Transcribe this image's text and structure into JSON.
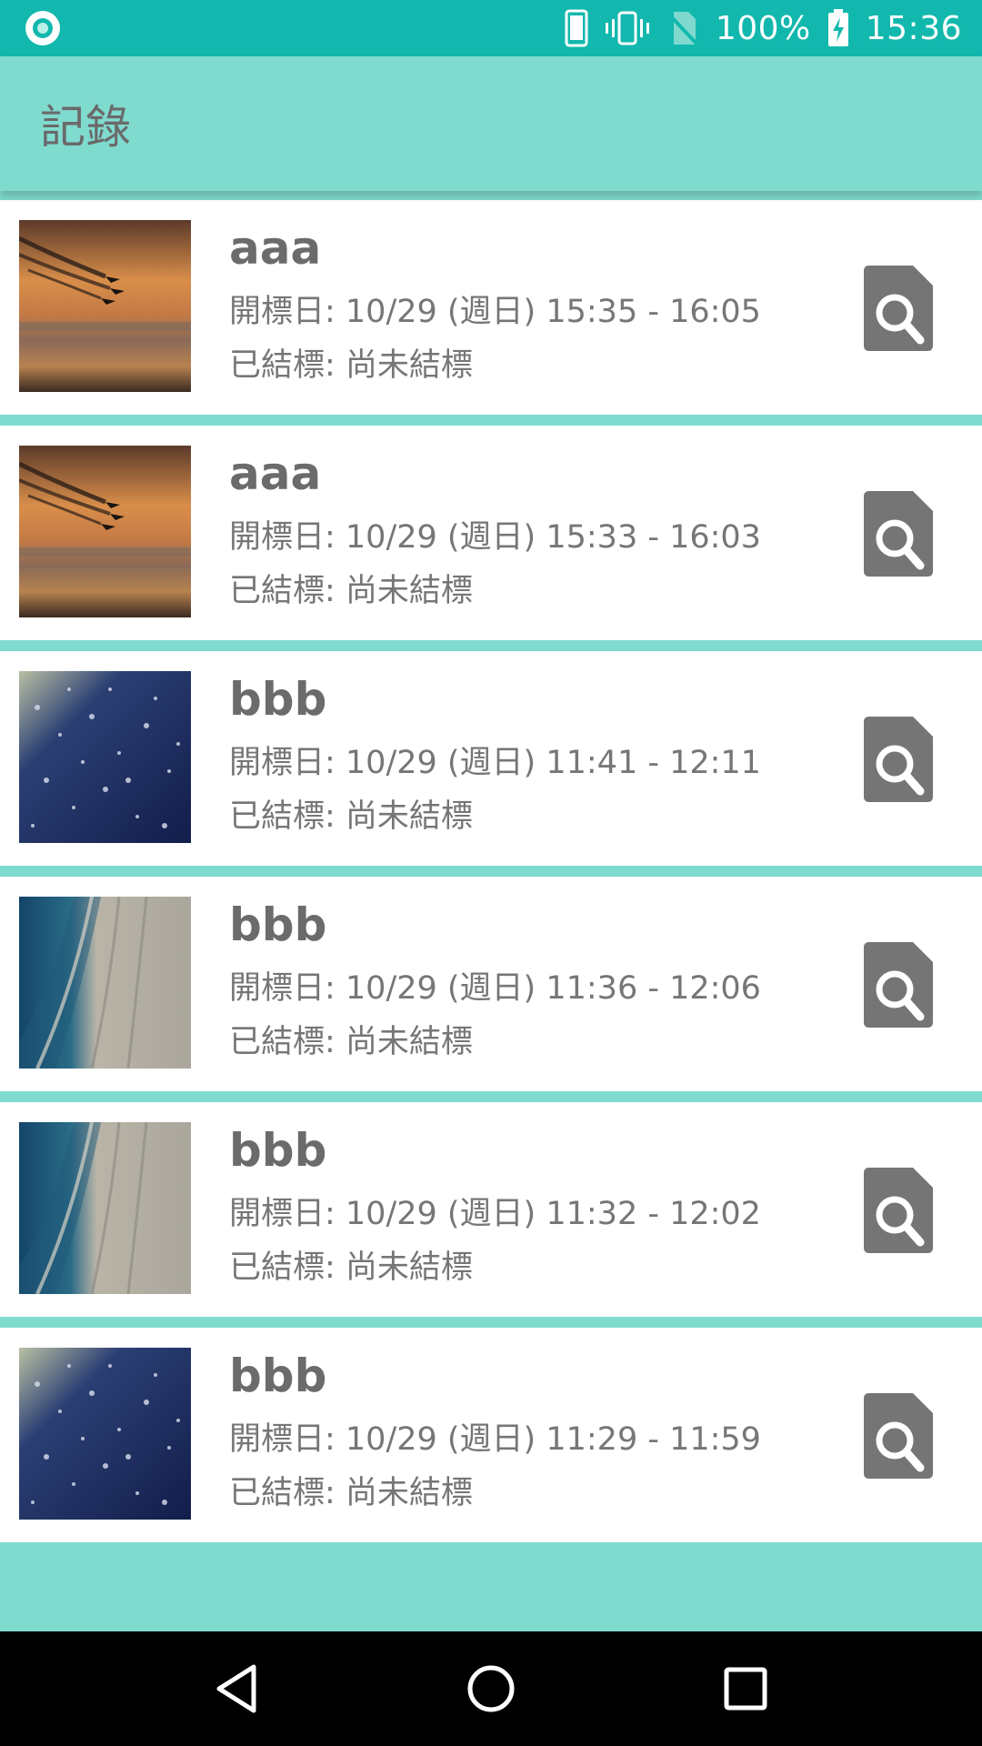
{
  "status_bar": {
    "battery": "100%",
    "time": "15:36",
    "icons": [
      "notification-icon",
      "phone-icon",
      "vibrate-icon",
      "no-sim-icon",
      "battery-charging-icon"
    ]
  },
  "app_bar": {
    "title": "記錄"
  },
  "items": [
    {
      "title": "aaa",
      "open_date": "開標日: 10/29 (週日) 15:35 - 16:05",
      "status": "已結標: 尚未結標",
      "thumbnail": "airplanes-sunset",
      "action_icon": "search-icon"
    },
    {
      "title": "aaa",
      "open_date": "開標日: 10/29 (週日) 15:33 - 16:03",
      "status": "已結標: 尚未結標",
      "thumbnail": "airplanes-sunset",
      "action_icon": "search-icon"
    },
    {
      "title": "bbb",
      "open_date": "開標日: 10/29 (週日) 11:41 - 12:11",
      "status": "已結標: 尚未結標",
      "thumbnail": "water-drops",
      "action_icon": "search-icon"
    },
    {
      "title": "bbb",
      "open_date": "開標日: 10/29 (週日) 11:36 - 12:06",
      "status": "已結標: 尚未結標",
      "thumbnail": "beach-aerial",
      "action_icon": "search-icon"
    },
    {
      "title": "bbb",
      "open_date": "開標日: 10/29 (週日) 11:32 - 12:02",
      "status": "已結標: 尚未結標",
      "thumbnail": "beach-aerial",
      "action_icon": "search-icon"
    },
    {
      "title": "bbb",
      "open_date": "開標日: 10/29 (週日) 11:29 - 11:59",
      "status": "已結標: 尚未結標",
      "thumbnail": "water-drops",
      "action_icon": "search-icon"
    }
  ],
  "nav_bar": {
    "icons": [
      "back-icon",
      "home-icon",
      "recents-icon"
    ]
  },
  "colors": {
    "status_bar": "#12B8AD",
    "app_bar": "#80DBCF",
    "text": "#767676",
    "icon": "#757575"
  }
}
